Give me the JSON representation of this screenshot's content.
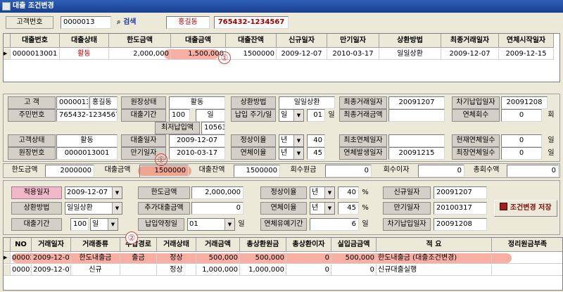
{
  "window": {
    "title": "대출 조건변경"
  },
  "search": {
    "cust_no_label": "고객번호",
    "cust_no": "0000013",
    "search_label": "검색",
    "name": "홍길동",
    "rrn": "765432-1234567"
  },
  "loan_grid": {
    "columns": [
      "대출번호",
      "대출상태",
      "한도금액",
      "대출금액",
      "대출잔액",
      "신규일자",
      "만기일자",
      "상환방법",
      "최종거래일자",
      "연체시작일자"
    ],
    "rows": [
      {
        "cells": [
          "0000013001",
          "활동",
          "2,000,000",
          "1,500,000",
          "1500000",
          "2009-12-07",
          "2010-03-17",
          "일일상환",
          "2009-12-07",
          "2009-12-15"
        ]
      }
    ]
  },
  "annotations": {
    "one": "①",
    "two": "②"
  },
  "info": {
    "cust_label": "고 객",
    "cust_no": "0000013",
    "cust_name": "홍길동",
    "acct_status_label": "원장상태",
    "acct_status": "활동",
    "repay_label": "상환방법",
    "repay": "일일상환",
    "last_tx_label": "최종거래일자",
    "last_tx": "20091207",
    "next_pay_label": "차기납입일자",
    "next_pay": "20091208",
    "rrn_label": "주민번호",
    "rrn": "765432-1234567",
    "period_label": "대출기간",
    "period": "100",
    "period_unit": "일",
    "pay_cycle_label": "납입 주기/일",
    "pay_cycle": "일",
    "pay_day": "01",
    "pay_day_unit": "일",
    "last_tx_amt_label": "최종거래금액",
    "last_tx_amt": "",
    "overdue_cnt_label": "연체회수",
    "overdue_cnt": "0",
    "overdue_cnt_unit": "회",
    "min_pay_label": "최저납입액",
    "min_pay": "10563",
    "cust_status_label": "고객상태",
    "cust_status": "활동",
    "loan_date_label": "대출일자",
    "loan_date": "2009-12-07",
    "normal_rate_label": "정상이율",
    "normal_rate_unit": "년",
    "normal_rate": "40",
    "last_overdue_label": "최초연체일자",
    "last_overdue": "",
    "cur_overdue_label": "현재연체일수",
    "cur_overdue": "0",
    "cur_overdue_unit": "일",
    "acct_no_label": "원장번호",
    "acct_no": "0000013001",
    "maturity_label": "만기일자",
    "maturity": "2010-03-17",
    "overdue_rate_label": "연체이율",
    "overdue_rate_unit": "년",
    "overdue_rate": "45",
    "overdue_occ_label": "연체발생일자",
    "overdue_occ": "20091215",
    "max_overdue_label": "최장연체일수",
    "max_overdue": "0",
    "max_overdue_unit": "일"
  },
  "amounts": {
    "limit_label": "한도금액",
    "limit": "2000000",
    "loan_label": "대출금액",
    "loan": "1500000",
    "balance_label": "대출잔액",
    "balance": "1500000",
    "collected_label": "회수원금",
    "collected": "0",
    "interest_label": "회수이자",
    "interest": "0",
    "total_label": "총회수액",
    "total": "0"
  },
  "edit": {
    "apply_label": "적용일자",
    "apply_date": "2009-12-07",
    "limit_label": "한도금액",
    "limit": "2,000,000",
    "normal_rate_label": "정상이율",
    "normal_rate_unit": "년",
    "normal_rate": "40",
    "pct": "%",
    "new_date_label": "신규일자",
    "new_date": "20091207",
    "repay_label": "상환방법",
    "repay": "일일상환",
    "add_loan_label": "추가대출금액",
    "add_loan": "0",
    "overdue_rate_label": "연체이율",
    "overdue_rate_unit": "년",
    "overdue_rate": "45",
    "maturity_label": "만기일자",
    "maturity": "20100317",
    "save_label": "조건변경 저장",
    "period_label": "대출기간",
    "period": "100",
    "period_unit": "일",
    "pay_day_label": "납입약정일",
    "pay_day": "01",
    "pay_day_unit": "일",
    "grace_label": "연체유예기간",
    "grace": "6",
    "grace_unit": "일",
    "next_pay_label": "차기납입일자",
    "next_pay": "20091208"
  },
  "tx_grid": {
    "columns": [
      "NO",
      "거래일자",
      "거래종류",
      "수납경로",
      "거래상태",
      "거래금액",
      "총상환원금",
      "총상환이자",
      "실입금금액",
      "적 요",
      "정리원금부족"
    ],
    "rows": [
      {
        "cells": [
          "00002",
          "2009-12-07",
          "한도내출금",
          "출금",
          "정상",
          "500,000",
          "500,000",
          "0",
          "500,000",
          "한도내출금 (대출조건변경)",
          ""
        ]
      },
      {
        "cells": [
          "00001",
          "2009-12-07",
          "신규",
          "",
          "정상",
          "1,000,000",
          "1,000,000",
          "0",
          "0",
          "신규대출실행",
          ""
        ]
      }
    ]
  }
}
